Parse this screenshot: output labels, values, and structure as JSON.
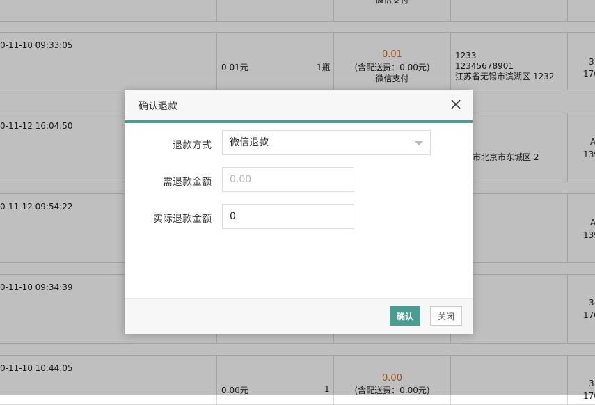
{
  "background_table": {
    "top_fragment": {
      "payment": "微信支付"
    },
    "rows": [
      {
        "datetime": "0-11-10 09:33:05",
        "price": "0.01元",
        "qty": "1瓶",
        "amount": "0.01",
        "delivery_fee": "(含配送费：0.00元)",
        "payment": "微信支付",
        "addr_line1": "1233",
        "addr_line2": "12345678901",
        "addr_line3": "江苏省无锡市滨湖区 1232",
        "edge_top": "3",
        "edge_bottom": "170"
      },
      {
        "datetime": "0-11-12 16:04:50",
        "addr_partial": "市北京市东城区 2",
        "edge_top": "A",
        "edge_bottom": "139"
      },
      {
        "datetime": "0-11-12 09:54:22",
        "edge_top": "A",
        "edge_bottom": "139"
      },
      {
        "datetime": "0-11-10 09:34:39",
        "edge_top": "3",
        "edge_bottom": "170"
      },
      {
        "datetime": "0-11-10 10:44:05",
        "price": "0.00元",
        "qty": "1",
        "amount": "0.00",
        "delivery_fee": "(含配送费：0.00元)",
        "edge_top": "3",
        "edge_bottom": "170"
      }
    ]
  },
  "modal": {
    "title": "确认退款",
    "fields": {
      "refund_method": {
        "label": "退款方式",
        "value": "微信退款"
      },
      "refund_due": {
        "label": "需退款金额",
        "value": "0.00"
      },
      "actual_refund": {
        "label": "实际退款金额",
        "value": "0"
      }
    },
    "buttons": {
      "confirm": "确认",
      "close": "关闭"
    },
    "colors": {
      "accent": "#4a9d90",
      "overlay": "rgba(0,0,0,0.25)"
    }
  }
}
